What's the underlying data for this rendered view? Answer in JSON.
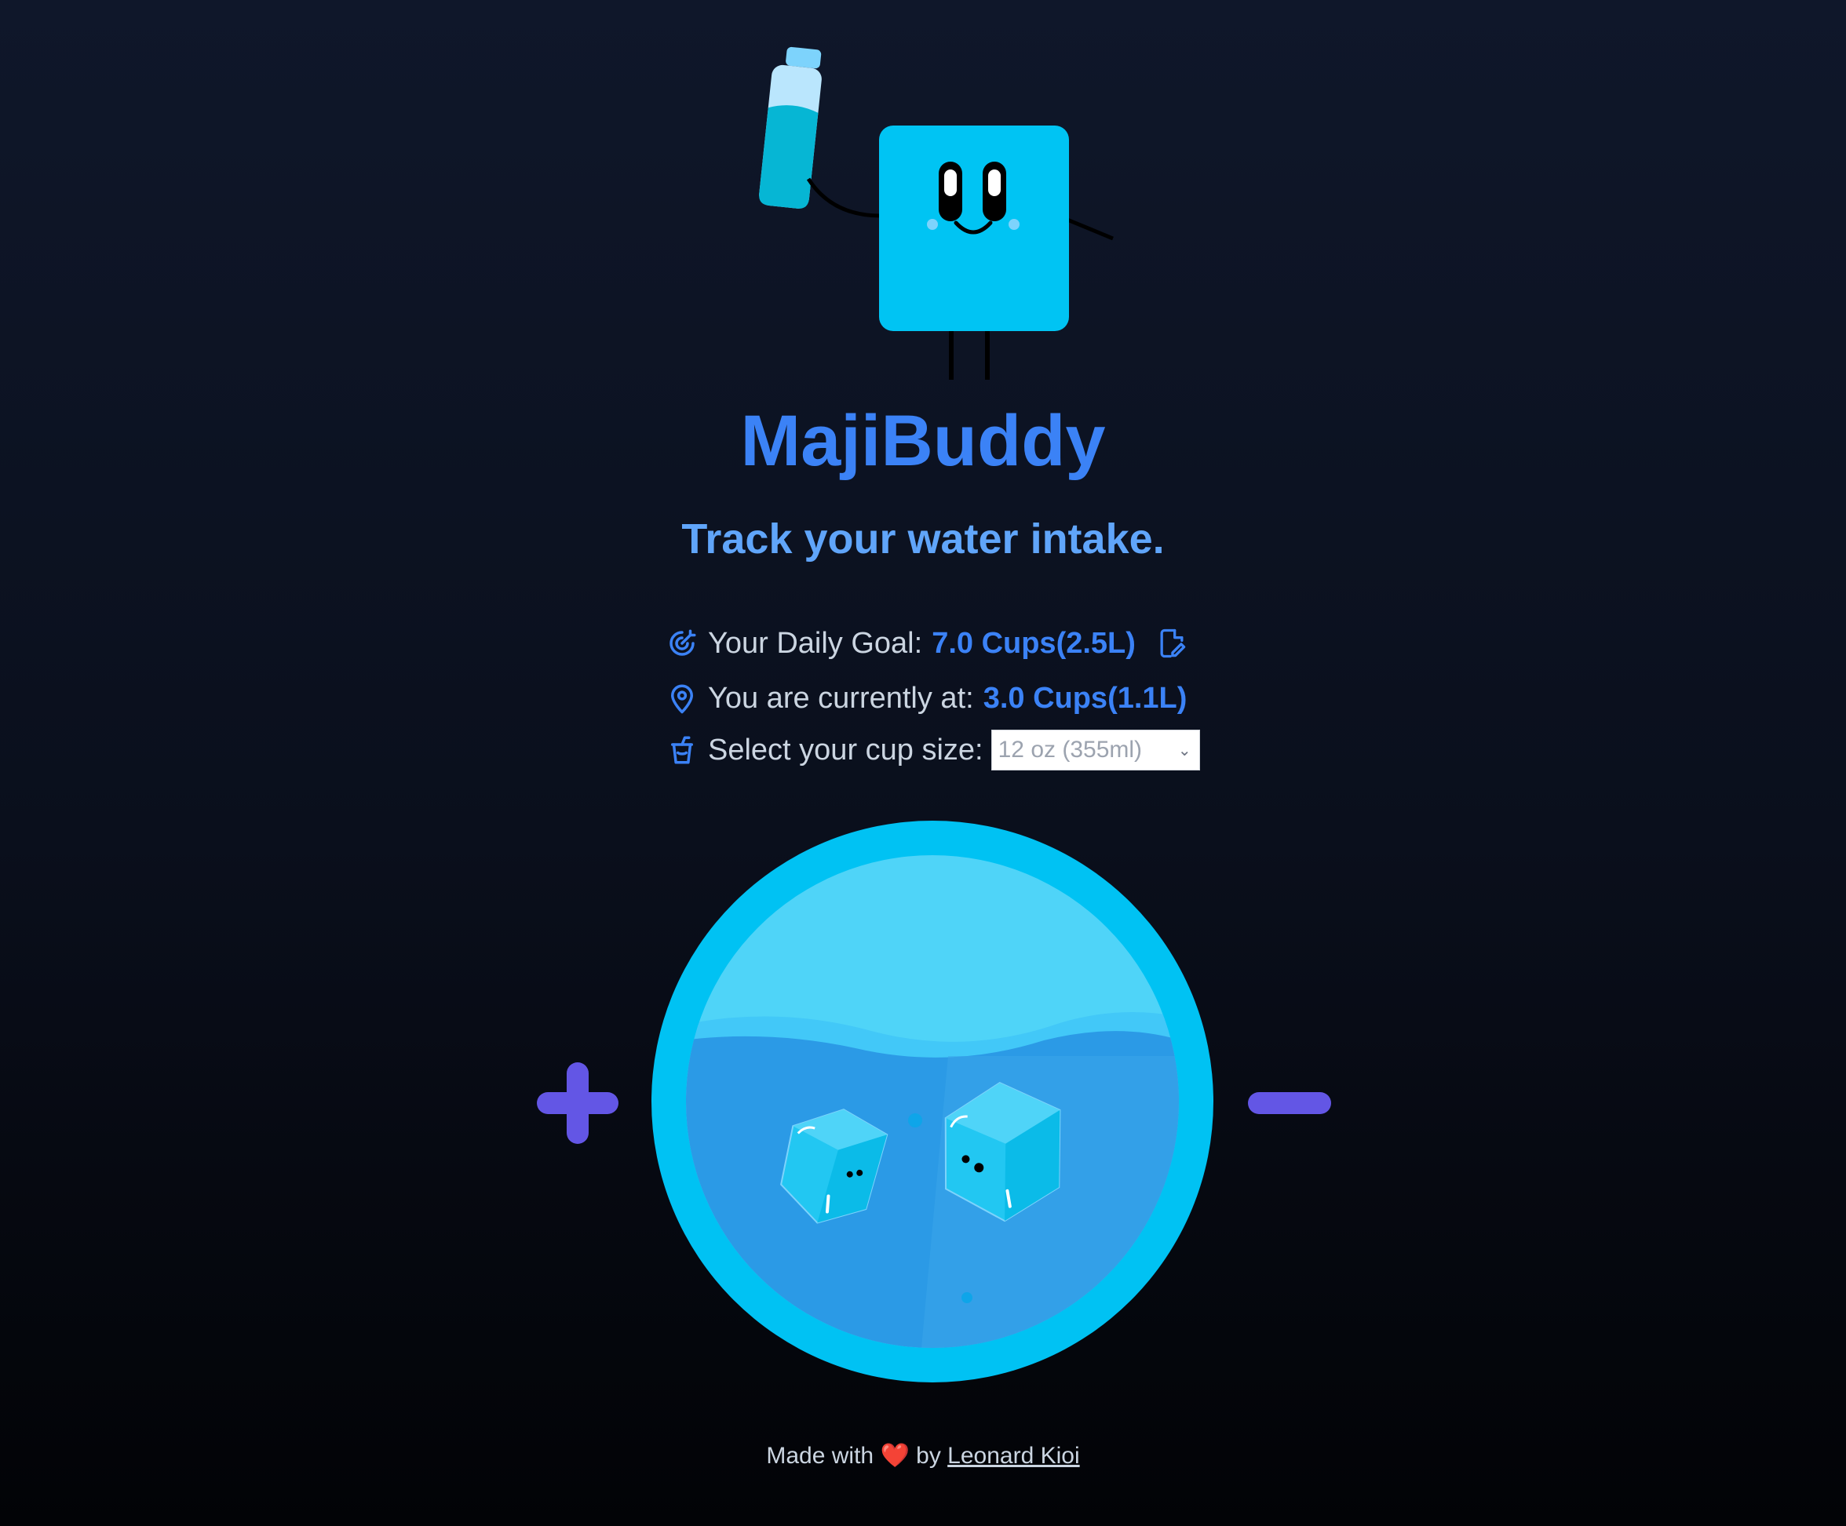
{
  "app": {
    "title": "MajiBuddy",
    "tagline": "Track your water intake."
  },
  "stats": {
    "goal_label": "Your Daily Goal:",
    "goal_value": "7.0 Cups(2.5L)",
    "current_label": "You are currently at:",
    "current_value": "3.0 Cups(1.1L)",
    "cup_size_label": "Select your cup size:",
    "cup_size_selected": "12 oz (355ml)",
    "progress_fraction": 0.43
  },
  "icons": {
    "goal": "target-icon",
    "current": "location-pin-icon",
    "cup": "cup-icon",
    "edit": "edit-file-icon",
    "add": "plus-icon",
    "remove": "minus-icon",
    "heart": "heart-icon"
  },
  "footer": {
    "prefix": "Made with",
    "heart": "❤️",
    "by": "by",
    "author": "Leonard Kioi"
  },
  "colors": {
    "accent": "#3b82f6",
    "accent_light": "#60a5fa",
    "water": "#2b9ae6",
    "bowl": "#00c2f3",
    "button": "#6356e5"
  }
}
